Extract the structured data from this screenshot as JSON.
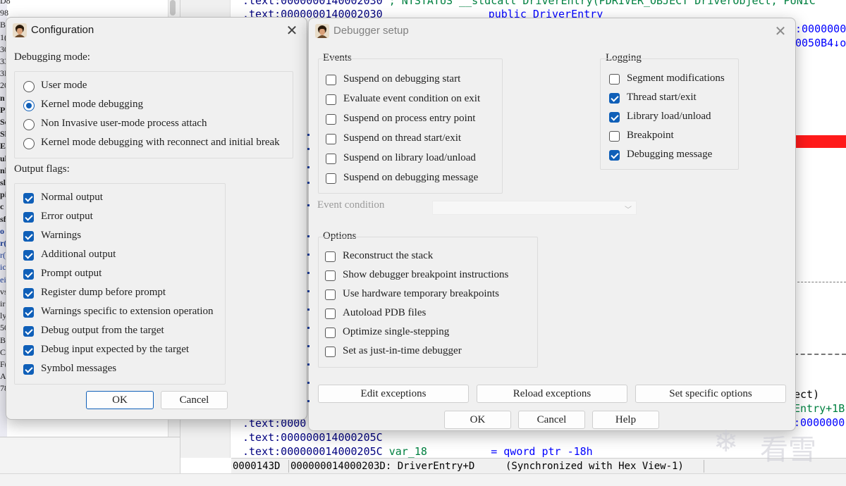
{
  "background": {
    "left_panel_chars": [
      "D8",
      "98",
      "B",
      "1(",
      "30",
      "33",
      "3E",
      "20",
      "n",
      "Pr",
      "Se",
      "Sl",
      "Ef",
      "ul",
      "nl",
      "sl",
      "pi",
      "c",
      "sf",
      "o",
      "r(",
      "r(",
      "ic",
      "ei",
      "vs",
      "ir",
      "ly",
      "50",
      "Bi",
      "C",
      "F(",
      "A8",
      "78"
    ],
    "code_lines": {
      "line0_a": ".text:0000000140002030",
      "line0_b": "; NTSTATUS __stdcall DriverEntry(PDRIVER_OBJECT DriverObject, PUNIC",
      "line1_a": ".text:0000000140002030",
      "line1_b": "public DriverEntry",
      "right1": ":0000000",
      "right2": "0050B4↓o",
      "right_ect": "ect)",
      "right_entry": "Entry+1B",
      "right_last": ":0000000",
      "line_a": ".text:0000",
      "line_b": ".text:000000014000205C",
      "line_c_addr": ".text:000000014000205C",
      "line_c_var": "var_18",
      "line_c_eq": "= qword ptr -18h"
    },
    "status": {
      "offset": "0000143D",
      "location": "000000014000203D: DriverEntry+D",
      "sync": "(Synchronized with Hex View-1)"
    }
  },
  "config_dialog": {
    "title": "Configuration",
    "close_glyph": "✕",
    "debug_mode_label": "Debugging mode:",
    "modes": [
      {
        "label": "User mode",
        "selected": false
      },
      {
        "label": "Kernel mode debugging",
        "selected": true
      },
      {
        "label": "Non Invasive user-mode process attach",
        "selected": false
      },
      {
        "label": "Kernel mode debugging with reconnect and initial break",
        "selected": false
      }
    ],
    "output_flags_label": "Output flags:",
    "flags": [
      {
        "label": "Normal output",
        "checked": true
      },
      {
        "label": "Error output",
        "checked": true
      },
      {
        "label": "Warnings",
        "checked": true
      },
      {
        "label": "Additional output",
        "checked": true
      },
      {
        "label": "Prompt output",
        "checked": true
      },
      {
        "label": "Register dump before prompt",
        "checked": true
      },
      {
        "label": "Warnings specific to extension operation",
        "checked": true
      },
      {
        "label": "Debug output from the target",
        "checked": true
      },
      {
        "label": "Debug input expected by the target",
        "checked": true
      },
      {
        "label": "Symbol messages",
        "checked": true
      }
    ],
    "ok_label": "OK",
    "cancel_label": "Cancel"
  },
  "debugger_dialog": {
    "title": "Debugger setup",
    "close_glyph": "✕",
    "events_label": "Events",
    "events": [
      {
        "label": "Suspend on debugging start",
        "checked": false
      },
      {
        "label": "Evaluate event condition on exit",
        "checked": false
      },
      {
        "label": "Suspend on process entry point",
        "checked": false
      },
      {
        "label": "Suspend on thread start/exit",
        "checked": false
      },
      {
        "label": "Suspend on library load/unload",
        "checked": false
      },
      {
        "label": "Suspend on debugging message",
        "checked": false
      }
    ],
    "logging_label": "Logging",
    "logging": [
      {
        "label": "Segment modifications",
        "checked": false
      },
      {
        "label": "Thread start/exit",
        "checked": true
      },
      {
        "label": "Library load/unload",
        "checked": true
      },
      {
        "label": "Breakpoint",
        "checked": false
      },
      {
        "label": "Debugging message",
        "checked": true
      }
    ],
    "event_condition_label": "Event condition",
    "event_condition_value": "",
    "options_label": "Options",
    "options": [
      {
        "label": "Reconstruct the stack",
        "checked": false
      },
      {
        "label": "Show debugger breakpoint instructions",
        "checked": false
      },
      {
        "label": "Use hardware temporary breakpoints",
        "checked": false
      },
      {
        "label": "Autoload PDB files",
        "checked": false
      },
      {
        "label": "Optimize single-stepping",
        "checked": false
      },
      {
        "label": "Set as just-in-time debugger",
        "checked": false
      }
    ],
    "edit_exceptions_label": "Edit exceptions",
    "reload_exceptions_label": "Reload exceptions",
    "set_specific_label": "Set specific options",
    "ok_label": "OK",
    "cancel_label": "Cancel",
    "help_label": "Help"
  },
  "watermark": {
    "text": "看雪"
  },
  "colors": {
    "accent": "#0f5fb8",
    "highlight_red": "#ff1a1a",
    "code_blue": "#000080"
  }
}
